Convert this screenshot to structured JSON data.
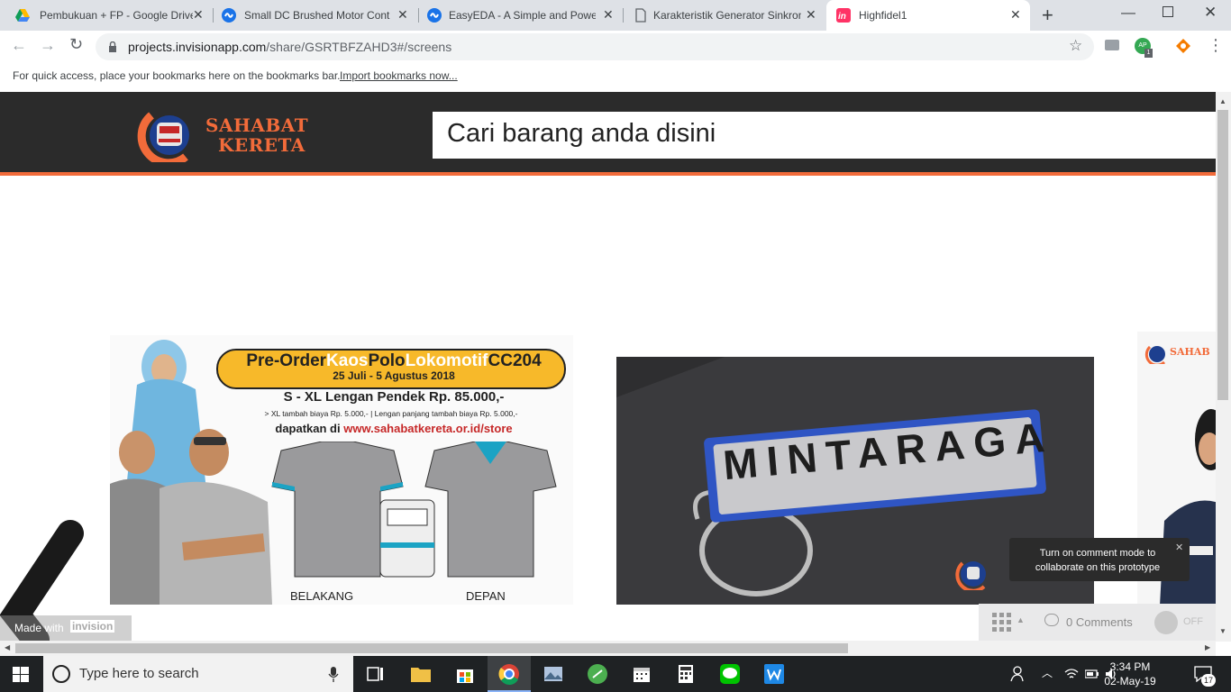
{
  "browser": {
    "tabs": [
      {
        "title": "Pembukuan + FP - Google Drive",
        "icon": "google-drive-icon"
      },
      {
        "title": "Small DC Brushed Motor Control",
        "icon": "easyeda-icon"
      },
      {
        "title": "EasyEDA - A Simple and Powerful",
        "icon": "easyeda-icon"
      },
      {
        "title": "Karakteristik Generator Sinkron",
        "icon": "document-icon"
      },
      {
        "title": "Highfidel1",
        "icon": "invision-icon"
      }
    ],
    "new_tab": "+",
    "url_host": "projects.invisionapp.com",
    "url_path": "/share/GSRTBFZAHD3#/screens",
    "profile_initials": "AP",
    "profile_badge": "1",
    "bookmarks_hint": "For quick access, place your bookmarks here on the bookmarks bar.",
    "import_link": "Import bookmarks now..."
  },
  "site": {
    "logo_line1": "SAHABAT",
    "logo_line2": "KERETA",
    "search_placeholder": "Cari barang anda disini",
    "banner1": {
      "headline_pre": "Pre-Order",
      "headline_kaos": "Kaos",
      "headline_polo": "Polo",
      "headline_lok": "Lokomotif",
      "headline_cc": "CC204",
      "dates": "25 Juli - 5 Agustus 2018",
      "price": "S - XL Lengan Pendek Rp. 85.000,-",
      "note": "> XL tambah biaya Rp. 5.000,- | Lengan panjang tambah biaya Rp. 5.000,-",
      "site_pre": "dapatkan di",
      "site_url": "www.sahabatkereta.or.id/store",
      "label_back": "BELAKANG",
      "label_front": "DEPAN"
    },
    "banner2": {
      "keychain_text": "MINTARAGA"
    },
    "banner3": {
      "logo": "SAHAB"
    }
  },
  "invision": {
    "made_with": "Made with",
    "brand": "invision",
    "comments": "0 Comments",
    "toggle": "OFF",
    "tooltip": "Turn on comment mode to collaborate on this prototype"
  },
  "taskbar": {
    "search_placeholder": "Type here to search",
    "time": "3:34 PM",
    "date": "02-May-19",
    "notification_count": "17"
  }
}
